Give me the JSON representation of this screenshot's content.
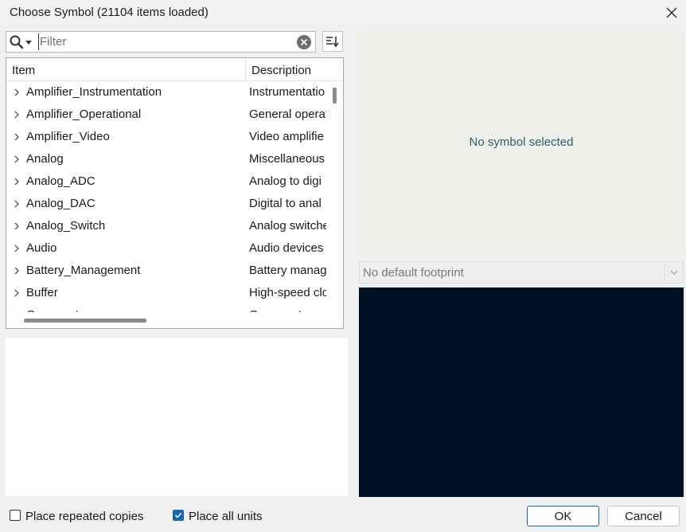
{
  "window": {
    "title": "Choose Symbol (21104 items loaded)",
    "close_icon": "close-icon"
  },
  "filter": {
    "placeholder": "Filter",
    "value": "",
    "search_icon": "search-icon",
    "clear_icon": "clear-icon",
    "sort_icon": "sort-icon"
  },
  "tree": {
    "columns": {
      "item": "Item",
      "description": "Description"
    },
    "rows": [
      {
        "name": "Amplifier_Instrumentation",
        "desc": "Instrumentatio"
      },
      {
        "name": "Amplifier_Operational",
        "desc": "General operat"
      },
      {
        "name": "Amplifier_Video",
        "desc": "Video amplifie"
      },
      {
        "name": "Analog",
        "desc": "Miscellaneous"
      },
      {
        "name": "Analog_ADC",
        "desc": "Analog to digi"
      },
      {
        "name": "Analog_DAC",
        "desc": "Digital to anal"
      },
      {
        "name": "Analog_Switch",
        "desc": "Analog switche"
      },
      {
        "name": "Audio",
        "desc": "Audio devices"
      },
      {
        "name": "Battery_Management",
        "desc": "Battery manag"
      },
      {
        "name": "Buffer",
        "desc": "High-speed clo"
      },
      {
        "name": "Comparator",
        "desc": "Comparator"
      }
    ]
  },
  "preview": {
    "no_symbol": "No symbol selected"
  },
  "footprint": {
    "selected": "No default footprint"
  },
  "options": {
    "repeated": {
      "label": "Place repeated copies",
      "checked": false
    },
    "all_units": {
      "label": "Place all units",
      "checked": true
    }
  },
  "buttons": {
    "ok": "OK",
    "cancel": "Cancel"
  },
  "colors": {
    "accent": "#1466b8",
    "preview_bg": "#efefea",
    "footprint_bg": "#001023",
    "status_text": "#2a5f6b"
  }
}
